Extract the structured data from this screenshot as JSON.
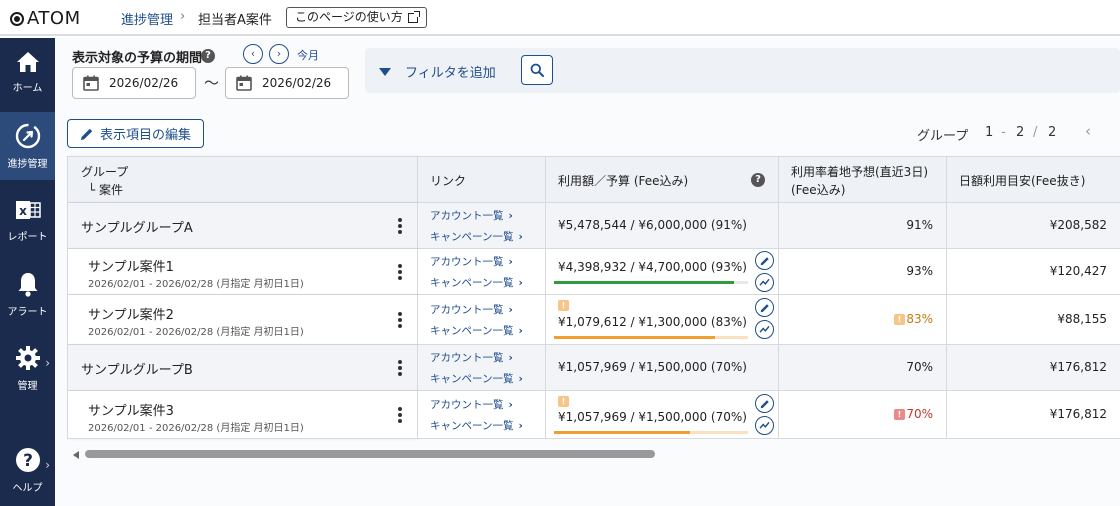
{
  "header": {
    "logo": "ATOM",
    "breadcrumb_parent": "進捗管理",
    "breadcrumb_current": "担当者A案件",
    "help_link": "このページの使い方"
  },
  "sidebar": {
    "items": [
      {
        "label": "ホーム",
        "icon": "home-icon"
      },
      {
        "label": "進捗管理",
        "icon": "progress-icon",
        "active": true
      },
      {
        "label": "レポート",
        "icon": "report-icon"
      },
      {
        "label": "アラート",
        "icon": "bell-icon"
      },
      {
        "label": "管理",
        "icon": "gear-icon"
      },
      {
        "label": "ヘルプ",
        "icon": "help-icon"
      }
    ]
  },
  "period": {
    "label": "表示対象の予算の期間",
    "this_month": "今月",
    "start": "2026/02/26",
    "separator": "〜",
    "end": "2026/02/26"
  },
  "filter": {
    "add_label": "フィルタを追加"
  },
  "toolbar": {
    "edit_columns": "表示項目の編集"
  },
  "pager": {
    "label": "グループ",
    "from": "1",
    "dash": "-",
    "to": "2",
    "slash": "/",
    "total": "2"
  },
  "table": {
    "headers": {
      "group": "グループ",
      "case": "└ 案件",
      "link": "リンク",
      "usage": "利用額／予算 (Fee込み)",
      "forecast_line1": "利用率着地予想(直近3日)",
      "forecast_line2": "(Fee込み)",
      "daily": "日額利用目安(Fee抜き)"
    },
    "link_account": "アカウント一覧",
    "link_campaign": "キャンペーン一覧",
    "rows": [
      {
        "type": "group",
        "name": "サンプルグループA",
        "usage": "¥5,478,544 / ¥6,000,000 (91%)",
        "forecast": "91%",
        "daily": "¥208,582"
      },
      {
        "type": "case",
        "name": "サンプル案件1",
        "period": "2026/02/01 - 2026/02/28 (月指定 月初日1日)",
        "usage": "¥4,398,932 / ¥4,700,000 (93%)",
        "progress": 0.93,
        "status": "ok",
        "forecast": "93%",
        "daily": "¥120,427"
      },
      {
        "type": "case",
        "name": "サンプル案件2",
        "period": "2026/02/01 - 2026/02/28 (月指定 月初日1日)",
        "usage": "¥1,079,612 / ¥1,300,000 (83%)",
        "progress": 0.83,
        "status": "warn",
        "forecast": "83%",
        "forecast_status": "warn",
        "daily": "¥88,155"
      },
      {
        "type": "group",
        "name": "サンプルグループB",
        "usage": "¥1,057,969 / ¥1,500,000 (70%)",
        "forecast": "70%",
        "daily": "¥176,812"
      },
      {
        "type": "case",
        "name": "サンプル案件3",
        "period": "2026/02/01 - 2026/02/28 (月指定 月初日1日)",
        "usage": "¥1,057,969 / ¥1,500,000 (70%)",
        "progress": 0.7,
        "status": "warn",
        "forecast": "70%",
        "forecast_status": "alert",
        "daily": "¥176,812"
      }
    ]
  },
  "colors": {
    "accent": "#1f4e8c",
    "sidebar": "#1a2b4d",
    "ok": "#2e9b3e",
    "warn": "#f0a030",
    "alert": "#e05a5a"
  }
}
